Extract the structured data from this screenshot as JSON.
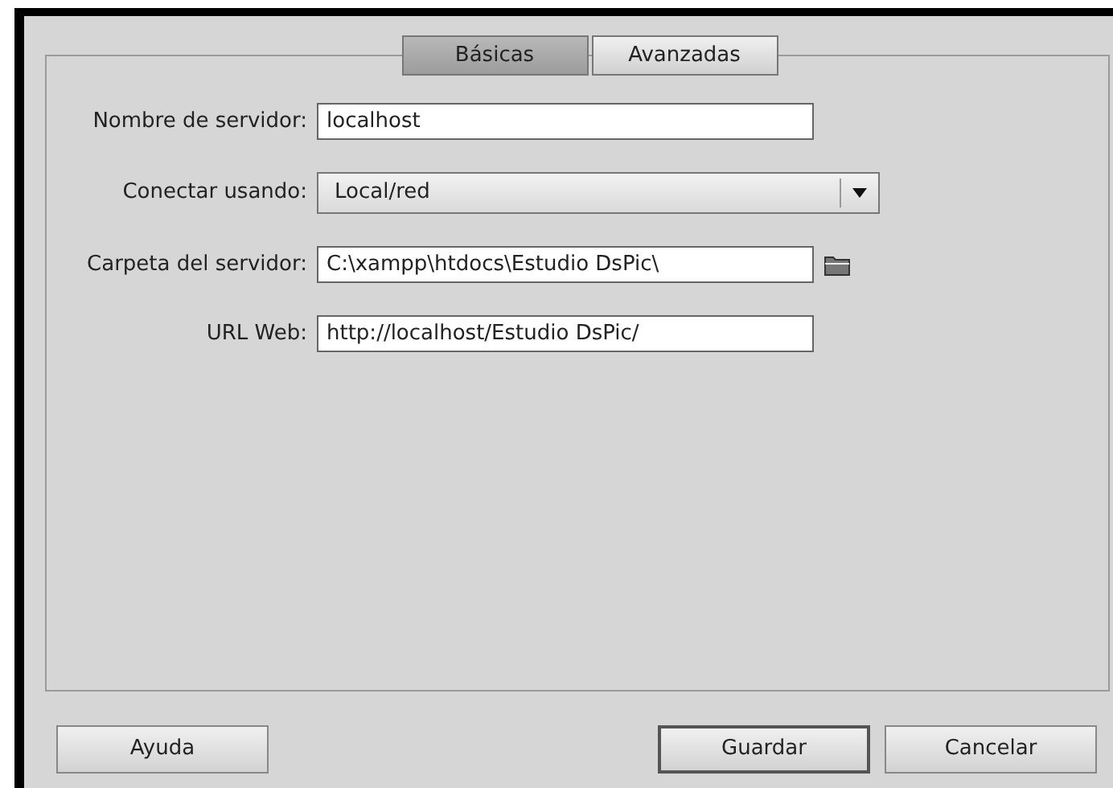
{
  "tabs": [
    {
      "label": "Básicas",
      "selected": true
    },
    {
      "label": "Avanzadas",
      "selected": false
    }
  ],
  "fields": [
    {
      "kind": "text",
      "label": "Nombre de servidor:",
      "value": "localhost"
    },
    {
      "kind": "select",
      "label": "Conectar usando:",
      "value": "Local/red"
    },
    {
      "kind": "folder",
      "label": "Carpeta del servidor:",
      "value": "C:\\xampp\\htdocs\\Estudio DsPic\\"
    },
    {
      "kind": "text",
      "label": "URL Web:",
      "value": "http://localhost/Estudio DsPic/"
    }
  ],
  "buttons": [
    {
      "label": "Ayuda",
      "default": false
    },
    {
      "label": "Guardar",
      "default": true
    },
    {
      "label": "Cancelar",
      "default": false
    }
  ]
}
